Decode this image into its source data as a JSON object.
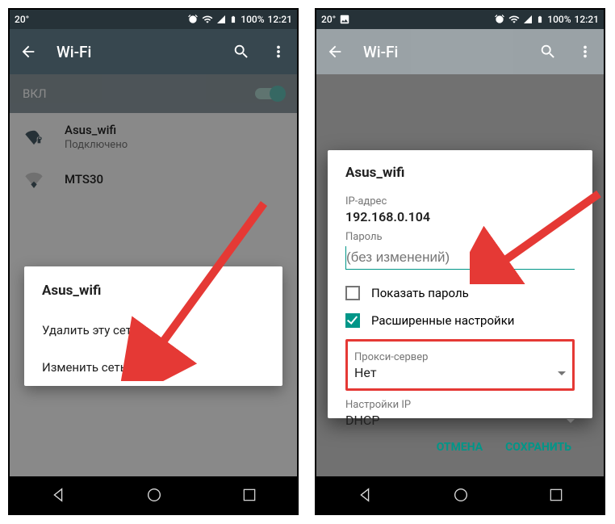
{
  "statusbar": {
    "temp": "20°",
    "battery": "100%",
    "time": "12:21"
  },
  "appbar": {
    "title": "Wi-Fi"
  },
  "toggle": {
    "label": "ВКЛ"
  },
  "wifi1": {
    "name": "Asus_wifi",
    "status": "Подключено"
  },
  "wifi2": {
    "name": "MTS30"
  },
  "ctx": {
    "title": "Asus_wifi",
    "delete": "Удалить эту сеть",
    "modify": "Изменить сеть"
  },
  "dlg": {
    "title": "Asus_wifi",
    "ip_label": "IP-адрес",
    "ip_value": "192.168.0.104",
    "pw_label": "Пароль",
    "pw_placeholder": "(без изменений)",
    "show_pw": "Показать пароль",
    "advanced": "Расширенные настройки",
    "proxy_label": "Прокси-сервер",
    "proxy_value": "Нет",
    "ipcfg_label": "Настройки IP",
    "ipcfg_value": "DHCP",
    "cancel": "ОТМЕНА",
    "save": "СОХРАНИТЬ"
  },
  "colors": {
    "accent": "#009688"
  }
}
